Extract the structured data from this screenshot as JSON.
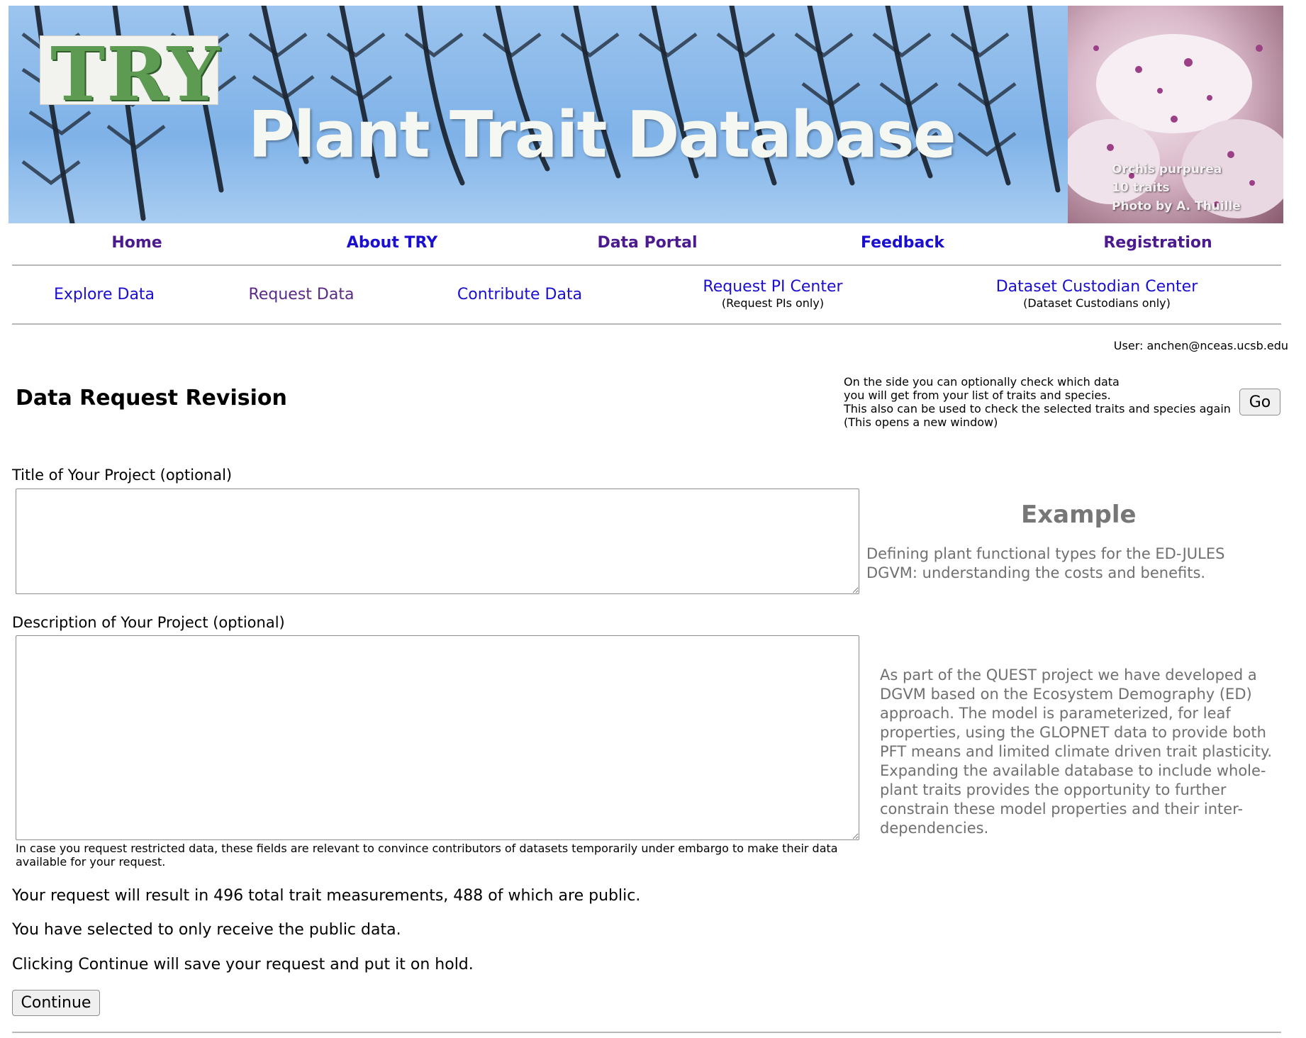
{
  "banner": {
    "logo_text": "TRY",
    "title": "Plant Trait Database",
    "photo_caption": [
      "Orchis purpurea",
      "10 traits",
      "Photo by A. Thuille"
    ]
  },
  "main_nav": [
    {
      "label": "Home",
      "color": "#4b1a8f"
    },
    {
      "label": "About TRY",
      "color": "#1a0fd0"
    },
    {
      "label": "Data Portal",
      "color": "#4b1a8f"
    },
    {
      "label": "Feedback",
      "color": "#1a0fd0"
    },
    {
      "label": "Registration",
      "color": "#4b1a8f"
    }
  ],
  "sub_nav": [
    {
      "label": "Explore Data",
      "note": "",
      "color": "#1a0fd0"
    },
    {
      "label": "Request Data",
      "note": "",
      "color": "#5b2a86"
    },
    {
      "label": "Contribute Data",
      "note": "",
      "color": "#1a0fd0"
    },
    {
      "label": "Request PI Center",
      "note": "(Request PIs only)",
      "color": "#1a0fd0"
    },
    {
      "label": "Dataset Custodian Center",
      "note": "(Dataset Custodians only)",
      "color": "#1a0fd0"
    }
  ],
  "user": "User: anchen@nceas.ucsb.edu",
  "page_title": "Data Request Revision",
  "go_help": [
    "On the side you can optionally check which data",
    "you will get from your list of traits and species.",
    "This also can be used to check the selected traits and species again",
    "(This opens a new window)"
  ],
  "go_label": "Go",
  "form": {
    "title_label": "Title of Your Project (optional)",
    "title_value": "",
    "description_label": "Description of Your Project (optional)",
    "description_value": "",
    "embargo_note": "In case you request restricted data, these fields are relevant to convince contributors of datasets temporarily under embargo to make their data available for your request."
  },
  "example": {
    "heading": "Example",
    "title": "Defining plant functional types for the ED-JULES DGVM: understanding the costs and benefits.",
    "description": "As part of the QUEST project we have developed a DGVM based on the Ecosystem Demography (ED) approach. The model is parameterized, for leaf properties, using the GLOPNET data to provide both PFT means and limited climate driven trait plasticity. Expanding the available database to include whole-plant traits provides the opportunity to further constrain these model properties and their inter-dependencies."
  },
  "summary": {
    "measurements": "Your request will result in 496 total trait measurements, 488 of which are public.",
    "public_only": "You have selected to only receive the public data.",
    "hold_notice": "Clicking Continue will save your request and put it on hold."
  },
  "continue_label": "Continue"
}
